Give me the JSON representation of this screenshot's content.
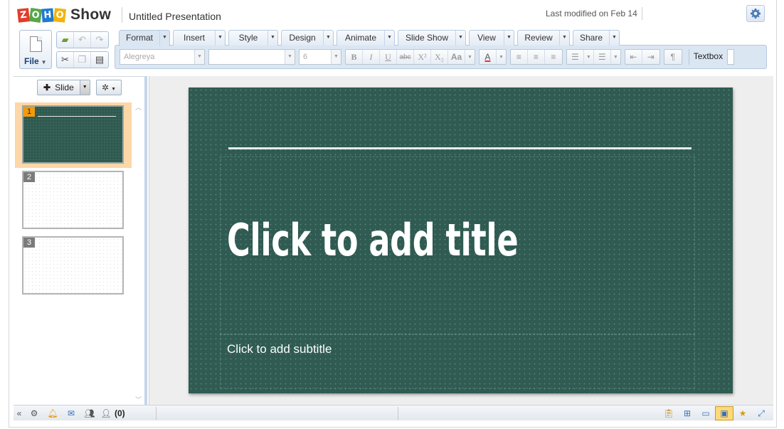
{
  "app": {
    "logo_letters": [
      "Z",
      "O",
      "H",
      "O"
    ],
    "name": "Show",
    "document_title": "Untitled Presentation",
    "last_modified": "Last modified on Feb 14"
  },
  "file_menu": {
    "label": "File",
    "icon": "document-icon"
  },
  "quick_access": {
    "row1": [
      {
        "name": "open-icon",
        "glyph": "📂"
      },
      {
        "name": "undo-icon",
        "glyph": "↶"
      },
      {
        "name": "redo-icon",
        "glyph": "↷"
      }
    ],
    "row2": [
      {
        "name": "cut-icon",
        "glyph": "✂"
      },
      {
        "name": "copy-icon",
        "glyph": "⎘"
      },
      {
        "name": "paste-icon",
        "glyph": "📋"
      }
    ]
  },
  "tabs": [
    {
      "label": "Format",
      "active": true
    },
    {
      "label": "Insert",
      "active": false
    },
    {
      "label": "Style",
      "active": false
    },
    {
      "label": "Design",
      "active": false
    },
    {
      "label": "Animate",
      "active": false
    },
    {
      "label": "Slide Show",
      "active": false
    },
    {
      "label": "View",
      "active": false
    },
    {
      "label": "Review",
      "active": false
    },
    {
      "label": "Share",
      "active": false
    }
  ],
  "format_bar": {
    "font_family": "Alegreya",
    "font_style": "",
    "font_size": "6",
    "textbox_label": "Textbox"
  },
  "slide_panel": {
    "new_slide_label": "Slide",
    "slides": [
      {
        "number": "1",
        "theme": "dark",
        "active": true
      },
      {
        "number": "2",
        "theme": "light",
        "active": false
      },
      {
        "number": "3",
        "theme": "light",
        "active": false
      }
    ]
  },
  "slide": {
    "title_placeholder": "Click to add title",
    "subtitle_placeholder": "Click to add subtitle",
    "background_color": "#2f5b52"
  },
  "status_bar": {
    "chat_count": "(0)"
  },
  "colors": {
    "accent": "#f29b0e",
    "ribbon": "#dbe6f3",
    "tab_border": "#b6c9df"
  }
}
